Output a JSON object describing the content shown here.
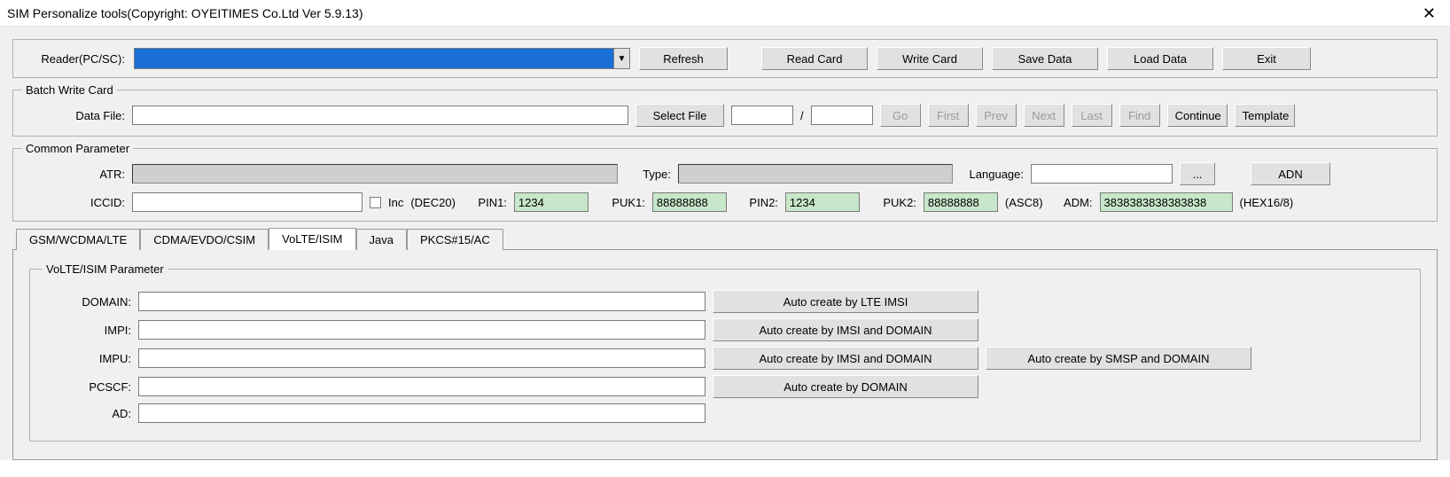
{
  "window": {
    "title": "SIM Personalize tools(Copyright: OYEITIMES Co.Ltd  Ver 5.9.13)"
  },
  "reader": {
    "label": "Reader(PC/SC):",
    "buttons": {
      "refresh": "Refresh",
      "read_card": "Read Card",
      "write_card": "Write Card",
      "save_data": "Save Data",
      "load_data": "Load Data",
      "exit": "Exit"
    }
  },
  "batch": {
    "legend": "Batch Write Card",
    "data_file_label": "Data File:",
    "select_file": "Select File",
    "slash": "/",
    "go": "Go",
    "first": "First",
    "prev": "Prev",
    "next": "Next",
    "last": "Last",
    "find": "Find",
    "continue": "Continue",
    "template": "Template"
  },
  "common": {
    "legend": "Common Parameter",
    "atr_label": "ATR:",
    "type_label": "Type:",
    "language_label": "Language:",
    "ellipsis": "...",
    "adn": "ADN",
    "iccid_label": "ICCID:",
    "inc_label": "Inc",
    "dec20": "(DEC20)",
    "pin1_label": "PIN1:",
    "pin1_value": "1234",
    "puk1_label": "PUK1:",
    "puk1_value": "88888888",
    "pin2_label": "PIN2:",
    "pin2_value": "1234",
    "puk2_label": "PUK2:",
    "puk2_value": "88888888",
    "asc8": "(ASC8)",
    "adm_label": "ADM:",
    "adm_value": "3838383838383838",
    "hex168": "(HEX16/8)"
  },
  "tabs": {
    "items": [
      {
        "label": "GSM/WCDMA/LTE"
      },
      {
        "label": "CDMA/EVDO/CSIM"
      },
      {
        "label": "VoLTE/ISIM"
      },
      {
        "label": "Java"
      },
      {
        "label": "PKCS#15/AC"
      }
    ]
  },
  "volte": {
    "legend": "VoLTE/ISIM  Parameter",
    "fields": {
      "domain": "DOMAIN:",
      "impi": "IMPI:",
      "impu": "IMPU:",
      "pcscf": "PCSCF:",
      "ad": "AD:"
    },
    "buttons": {
      "auto_lte_imsi": "Auto create by LTE IMSI",
      "auto_imsi_domain": "Auto create by IMSI and DOMAIN",
      "auto_imsi_domain2": "Auto create by IMSI and DOMAIN",
      "auto_smsp_domain": "Auto create by SMSP and DOMAIN",
      "auto_domain": "Auto create by DOMAIN"
    }
  }
}
